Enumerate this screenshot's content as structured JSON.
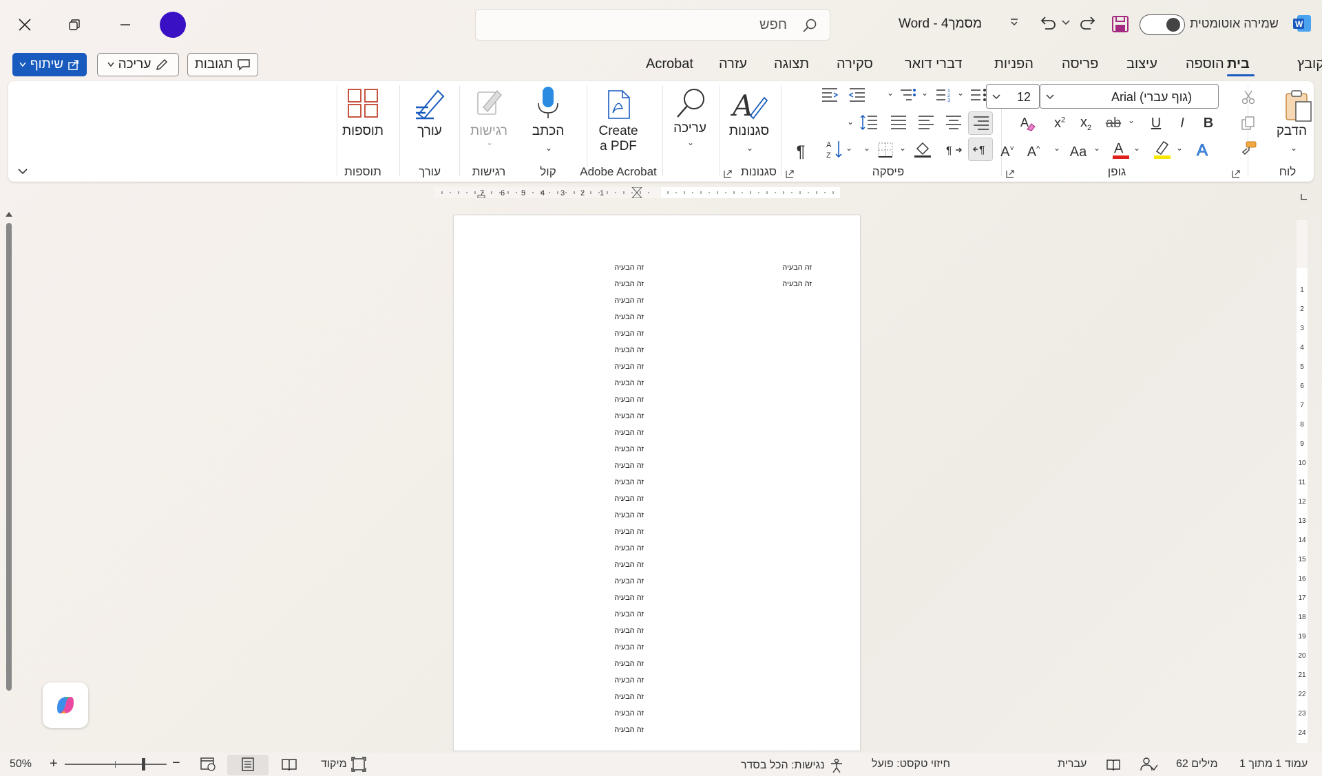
{
  "app": {
    "name": "Word",
    "doc_title": "מסמך4 - Word",
    "autosave_label": "שמירה אוטומטית",
    "search_placeholder": "חפש"
  },
  "header": {
    "share_label": "שיתוף",
    "editing_label": "עריכה",
    "comments_label": "תגובות"
  },
  "tabs": [
    {
      "label": "קובץ"
    },
    {
      "label": "בית"
    },
    {
      "label": "הוספה"
    },
    {
      "label": "עיצוב"
    },
    {
      "label": "פריסה"
    },
    {
      "label": "הפניות"
    },
    {
      "label": "דברי דואר"
    },
    {
      "label": "סקירה"
    },
    {
      "label": "תצוגה"
    },
    {
      "label": "עזרה"
    },
    {
      "label": "Acrobat"
    }
  ],
  "ribbon": {
    "clipboard": {
      "group": "לוח",
      "paste": "הדבק"
    },
    "font": {
      "group": "גופן",
      "font_name": "Arial (גוף עברי)",
      "font_size": "12"
    },
    "paragraph": {
      "group": "פיסקה"
    },
    "styles": {
      "group": "סגנונות",
      "button": "סגנונות"
    },
    "editing": {
      "button": "עריכה"
    },
    "acrobat": {
      "group": "Adobe Acrobat",
      "line1": "Create",
      "line2": "a PDF"
    },
    "voice": {
      "group": "קול",
      "button": "הכתב"
    },
    "sensitivity": {
      "group": "רגישות",
      "button": "רגישות"
    },
    "editor": {
      "group": "עורך",
      "button": "עורך"
    },
    "addins": {
      "group": "תוספות",
      "button": "תוספות"
    }
  },
  "document": {
    "right_column": [
      "זה הבעיה",
      "זה הבעיה"
    ],
    "left_column": [
      "זה הבעיה",
      "זה הבעיה",
      "זה הבעיה",
      "זה הבעיה",
      "זה הבעיה",
      "זה הבעיה",
      "זה הבעיה",
      "זה הבעיה",
      "זה הבעיה",
      "זה הבעיה",
      "זה הבעיה",
      "זה הבעיה",
      "זה הבעיה",
      "זה הבעיה",
      "זה הבעיה",
      "זה הבעיה",
      "זה הבעיה",
      "זה הבעיה",
      "זה הבעיה",
      "זה הבעיה",
      "זה הבעיה",
      "זה הבעיה",
      "זה הבעיה",
      "זה הבעיה",
      "זה הבעיה",
      "זה הבעיה",
      "זה הבעיה",
      "זה הבעיה",
      "זה הבעיה"
    ]
  },
  "status": {
    "page": "עמוד 1 מתוך 1",
    "words": "62 מילים",
    "language": "עברית",
    "text_prediction": "חיזוי טקסט: פועל",
    "accessibility": "נגישות: הכל בסדר",
    "focus": "מיקוד",
    "zoom": "50%"
  },
  "colors": {
    "accent": "#185abd",
    "avatar": "#3a10c4"
  }
}
